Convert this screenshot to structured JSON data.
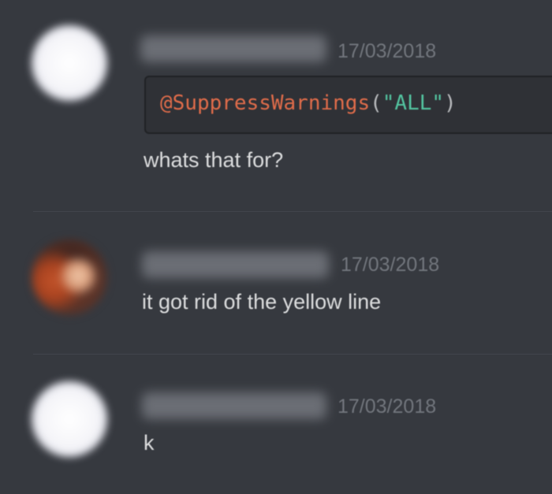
{
  "messages": [
    {
      "timestamp": "17/03/2018",
      "code": {
        "annotation": "@SuppressWarnings",
        "open_paren": "(",
        "string": "\"ALL\"",
        "close_paren": ")"
      },
      "text": "whats that for?"
    },
    {
      "timestamp": "17/03/2018",
      "text": "it got rid of the yellow line"
    },
    {
      "timestamp": "17/03/2018",
      "text": "k"
    }
  ],
  "colors": {
    "background": "#36393f",
    "code_background": "#2f3136",
    "text": "#dcddde",
    "timestamp": "#72767d",
    "annotation": "#e06c4a",
    "string": "#53c4a0"
  }
}
